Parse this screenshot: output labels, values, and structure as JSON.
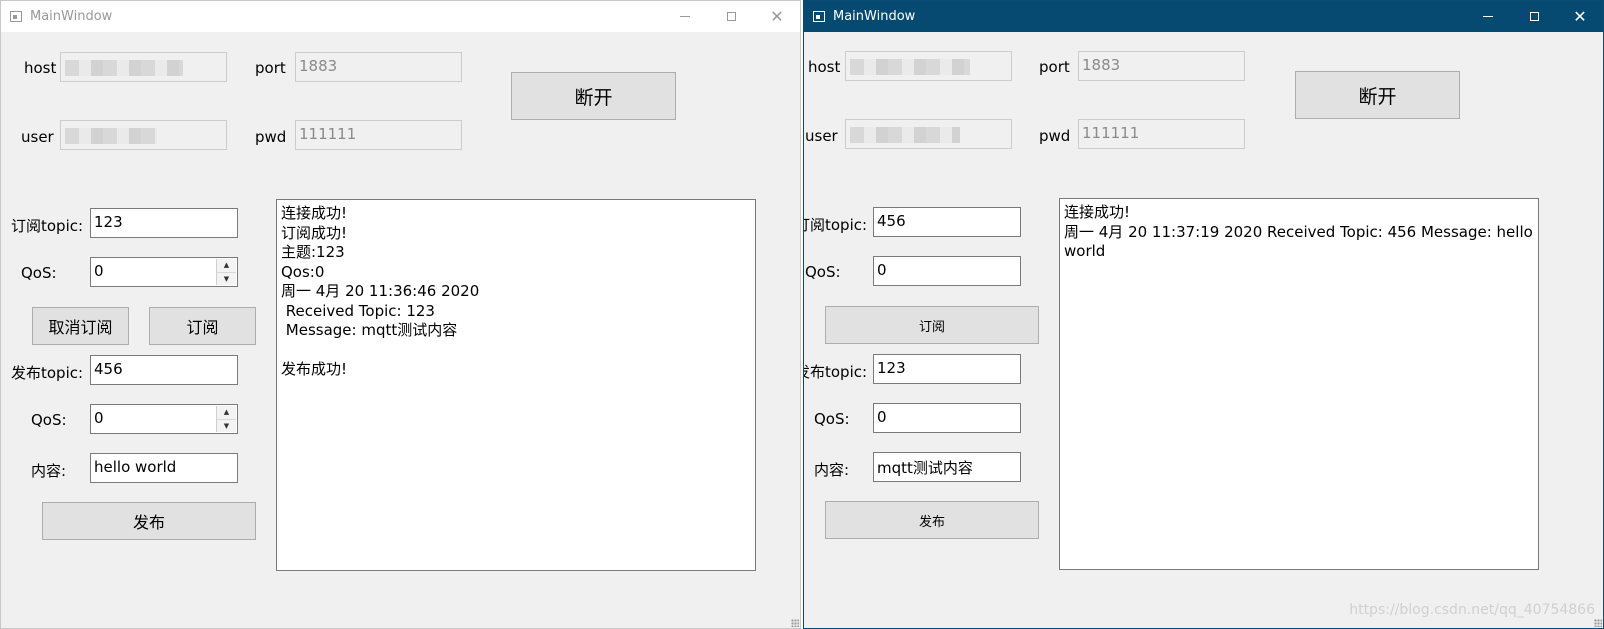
{
  "left_window": {
    "title": "MainWindow",
    "host_label": "host",
    "port_label": "port",
    "port_value": "1883",
    "user_label": "user",
    "pwd_label": "pwd",
    "pwd_value": "111111",
    "disconnect_label": "断开",
    "sub_topic_label": "订阅topic:",
    "sub_topic_value": "123",
    "sub_qos_label": "QoS:",
    "sub_qos_value": "0",
    "unsubscribe_label": "取消订阅",
    "subscribe_label": "订阅",
    "pub_topic_label": "发布topic:",
    "pub_topic_value": "456",
    "pub_qos_label": "QoS:",
    "pub_qos_value": "0",
    "content_label": "内容:",
    "content_value": "hello world",
    "publish_label": "发布",
    "log_lines": [
      "连接成功!",
      "订阅成功!",
      "主题:123",
      "Qos:0",
      "周一 4月 20 11:36:46 2020",
      " Received Topic: 123",
      " Message: mqtt测试内容",
      "",
      "发布成功!"
    ]
  },
  "right_window": {
    "title": "MainWindow",
    "host_label": "host",
    "port_label": "port",
    "port_value": "1883",
    "user_label": "user",
    "pwd_label": "pwd",
    "pwd_value": "111111",
    "disconnect_label": "断开",
    "sub_topic_label": "订阅topic:",
    "sub_topic_value": "456",
    "sub_qos_label": "QoS:",
    "sub_qos_value": "0",
    "subscribe_label": "订阅",
    "pub_topic_label": "发布topic:",
    "pub_topic_value": "123",
    "pub_qos_label": "QoS:",
    "pub_qos_value": "0",
    "content_label": "内容:",
    "content_value": "mqtt测试内容",
    "publish_label": "发布",
    "log_lines": [
      "连接成功!",
      "周一 4月 20 11:37:19 2020 Received Topic: 456 Message: hello world"
    ]
  },
  "watermark": "https://blog.csdn.net/qq_40754866",
  "icons": {
    "app": "window-app-icon",
    "minimize": "minimize-icon",
    "maximize": "maximize-icon",
    "close": "close-icon",
    "spin_up": "spin-up-icon",
    "spin_down": "spin-down-icon"
  },
  "colors": {
    "active_titlebar": "#064a71",
    "inactive_titlebar": "#ffffff",
    "window_bg": "#f0f0f0",
    "button_bg": "#e1e1e1"
  }
}
